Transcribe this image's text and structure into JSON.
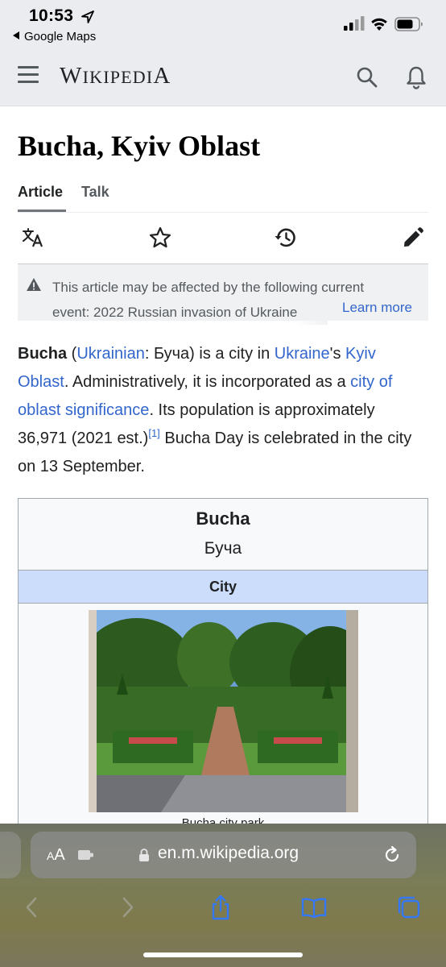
{
  "status_bar": {
    "time": "10:53",
    "back_app": "Google Maps"
  },
  "header": {
    "logo_first": "W",
    "logo_rest": "IKIPEDI",
    "logo_last": "A",
    "icons": [
      "menu-icon",
      "search-icon",
      "bell-icon"
    ]
  },
  "page": {
    "title": "Bucha, Kyiv Oblast",
    "tabs": [
      {
        "label": "Article",
        "active": true
      },
      {
        "label": "Talk",
        "active": false
      }
    ],
    "actions": [
      "language-icon",
      "star-icon",
      "history-icon",
      "edit-icon"
    ]
  },
  "notice": {
    "line1": "This article may be affected by the following current",
    "line2": "event: 2022 Russian invasion of Ukraine",
    "learn_more": "Learn more"
  },
  "lead": {
    "name": "Bucha",
    "open_paren": " (",
    "lang_link": "Ukrainian",
    "native": ": Буча) is a city in ",
    "country_link": "Ukraine",
    "possessive": "'s ",
    "oblast_link": "Kyiv Oblast",
    "admin_text": ". Administratively, it is incorporated as a ",
    "significance_link": "city of oblast significance",
    "population_text": ". Its population is approximately 36,971 (2021 est.)",
    "ref": "[1]",
    "day_text": " Bucha Day is celebrated in the city on 13 September."
  },
  "infobox": {
    "title": "Bucha",
    "native_name": "Буча",
    "type": "City",
    "image_caption": "Bucha city park"
  },
  "safari": {
    "aa_small": "A",
    "aa_large": "A",
    "url": "en.m.wikipedia.org",
    "toolbar": [
      "back-icon",
      "forward-icon",
      "share-icon",
      "bookmarks-icon",
      "tabs-icon"
    ]
  },
  "colors": {
    "link": "#3366cc",
    "header_bg": "#eaecf0",
    "infobox_type_bg": "#ccddfb",
    "ios_blue": "#3478f6"
  }
}
